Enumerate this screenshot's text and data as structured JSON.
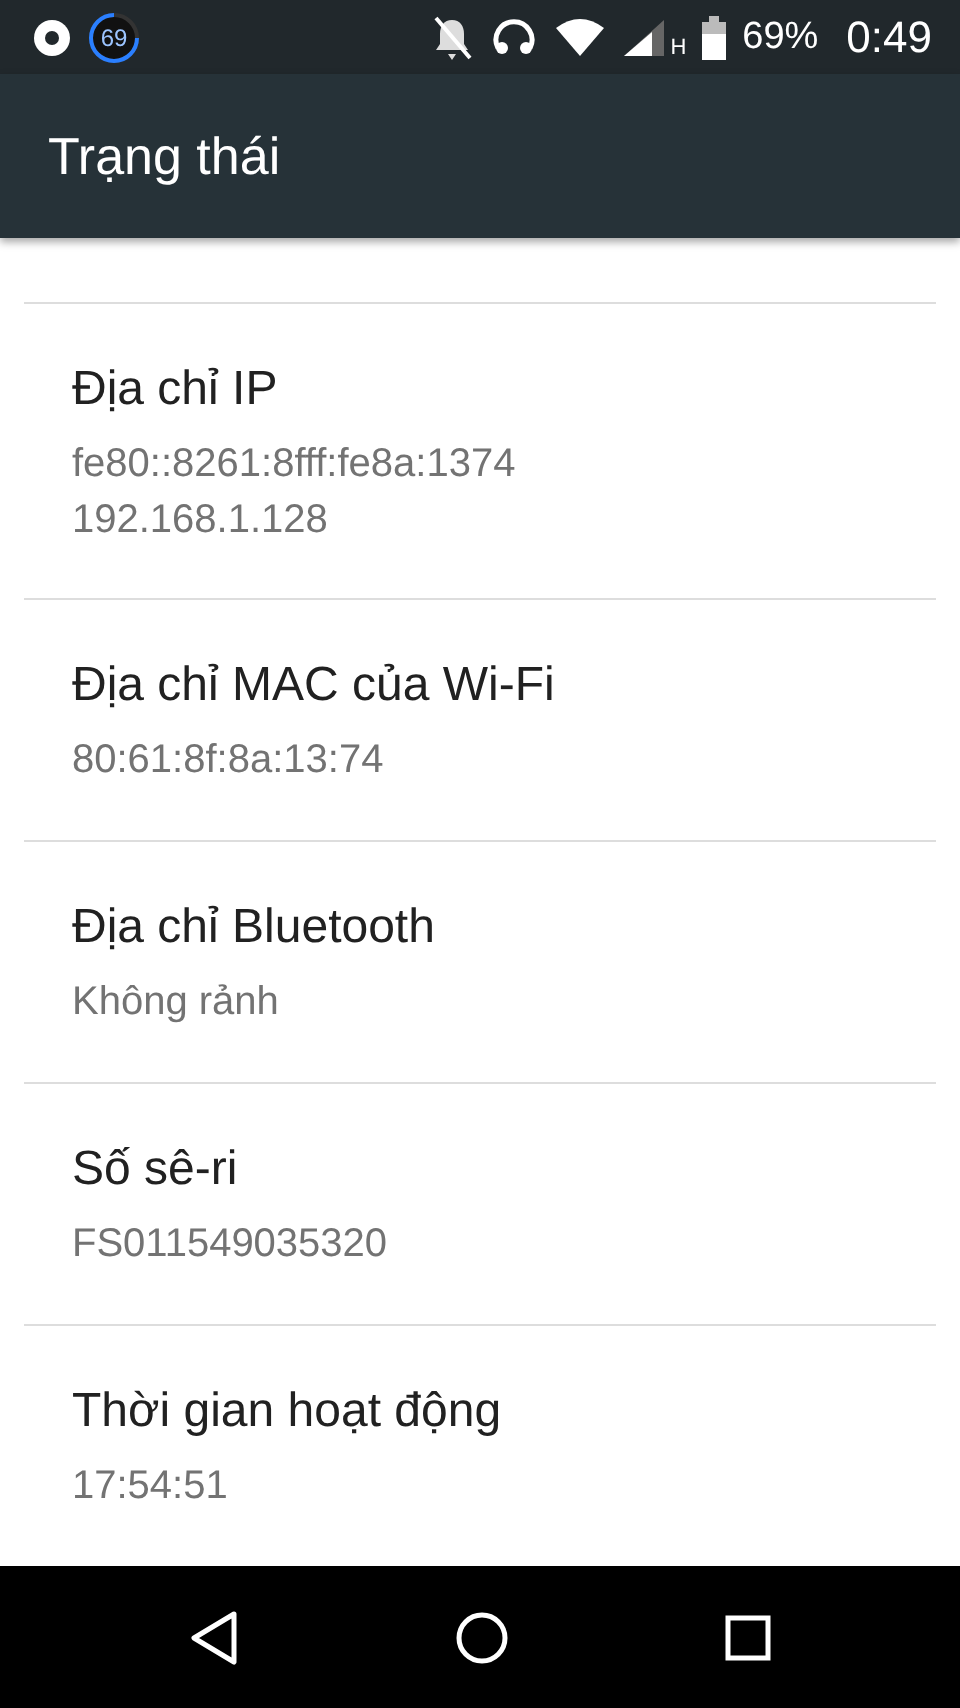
{
  "status_bar": {
    "badge": "69",
    "battery": "69%",
    "time": "0:49",
    "network": "H"
  },
  "app_bar": {
    "title": "Trạng thái"
  },
  "items": [
    {
      "title": "Địa chỉ IP",
      "values": [
        "fe80::8261:8fff:fe8a:1374",
        "192.168.1.128"
      ]
    },
    {
      "title": "Địa chỉ MAC của Wi-Fi",
      "values": [
        "80:61:8f:8a:13:74"
      ]
    },
    {
      "title": "Địa chỉ Bluetooth",
      "values": [
        "Không rảnh"
      ]
    },
    {
      "title": "Số sê-ri",
      "values": [
        "FS011549035320"
      ]
    },
    {
      "title": "Thời gian hoạt động",
      "values": [
        "17:54:51"
      ]
    }
  ]
}
